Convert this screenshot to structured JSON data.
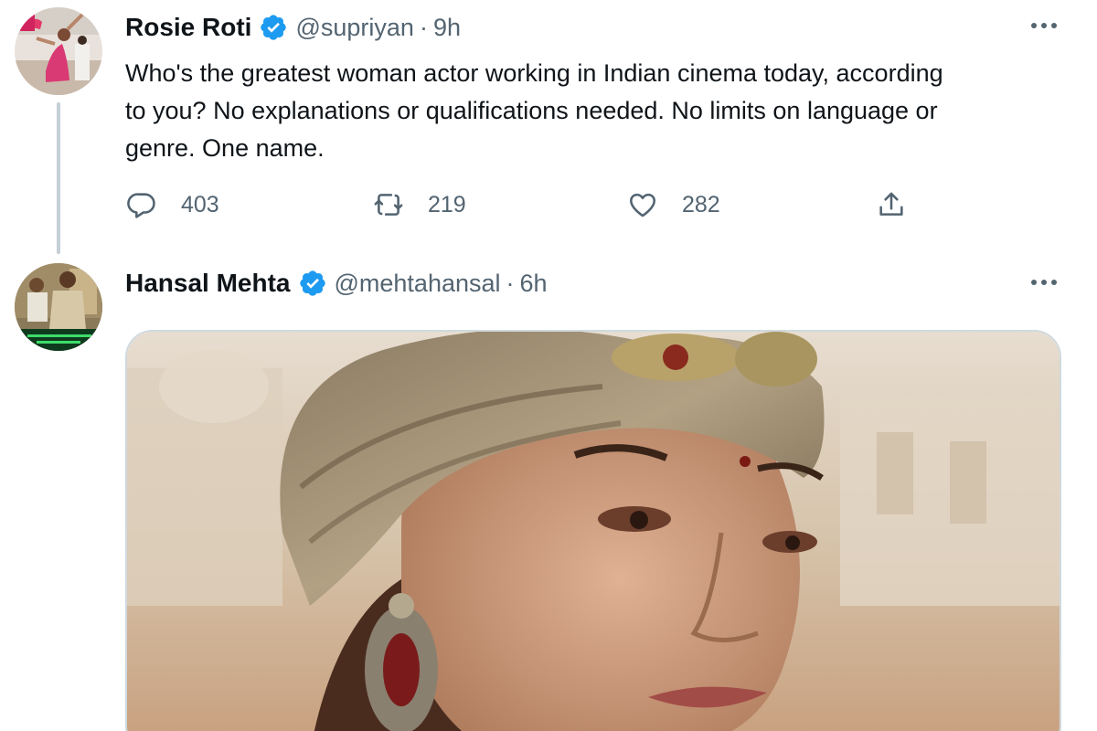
{
  "tweets": [
    {
      "display_name": "Rosie Roti",
      "handle": "@supriyan",
      "separator": "·",
      "time": "9h",
      "text": "Who's the greatest woman actor working in Indian cinema today, according\nto you? No explanations or qualifications needed. No limits on language or\ngenre. One name.",
      "actions": {
        "reply_count": "403",
        "retweet_count": "219",
        "like_count": "282"
      }
    },
    {
      "display_name": "Hansal Mehta",
      "handle": "@mehtahansal",
      "separator": "·",
      "time": "6h"
    }
  ],
  "icons": {
    "verified": "verified-badge-icon",
    "more": "more-horizontal-icon",
    "reply": "reply-icon",
    "retweet": "retweet-icon",
    "like": "heart-icon",
    "share": "share-icon"
  },
  "colors": {
    "accent": "#1d9bf0",
    "secondary_text": "#536471",
    "primary_text": "#0f1419",
    "border": "#cfd9de",
    "thread_line": "#c4cfd6"
  }
}
